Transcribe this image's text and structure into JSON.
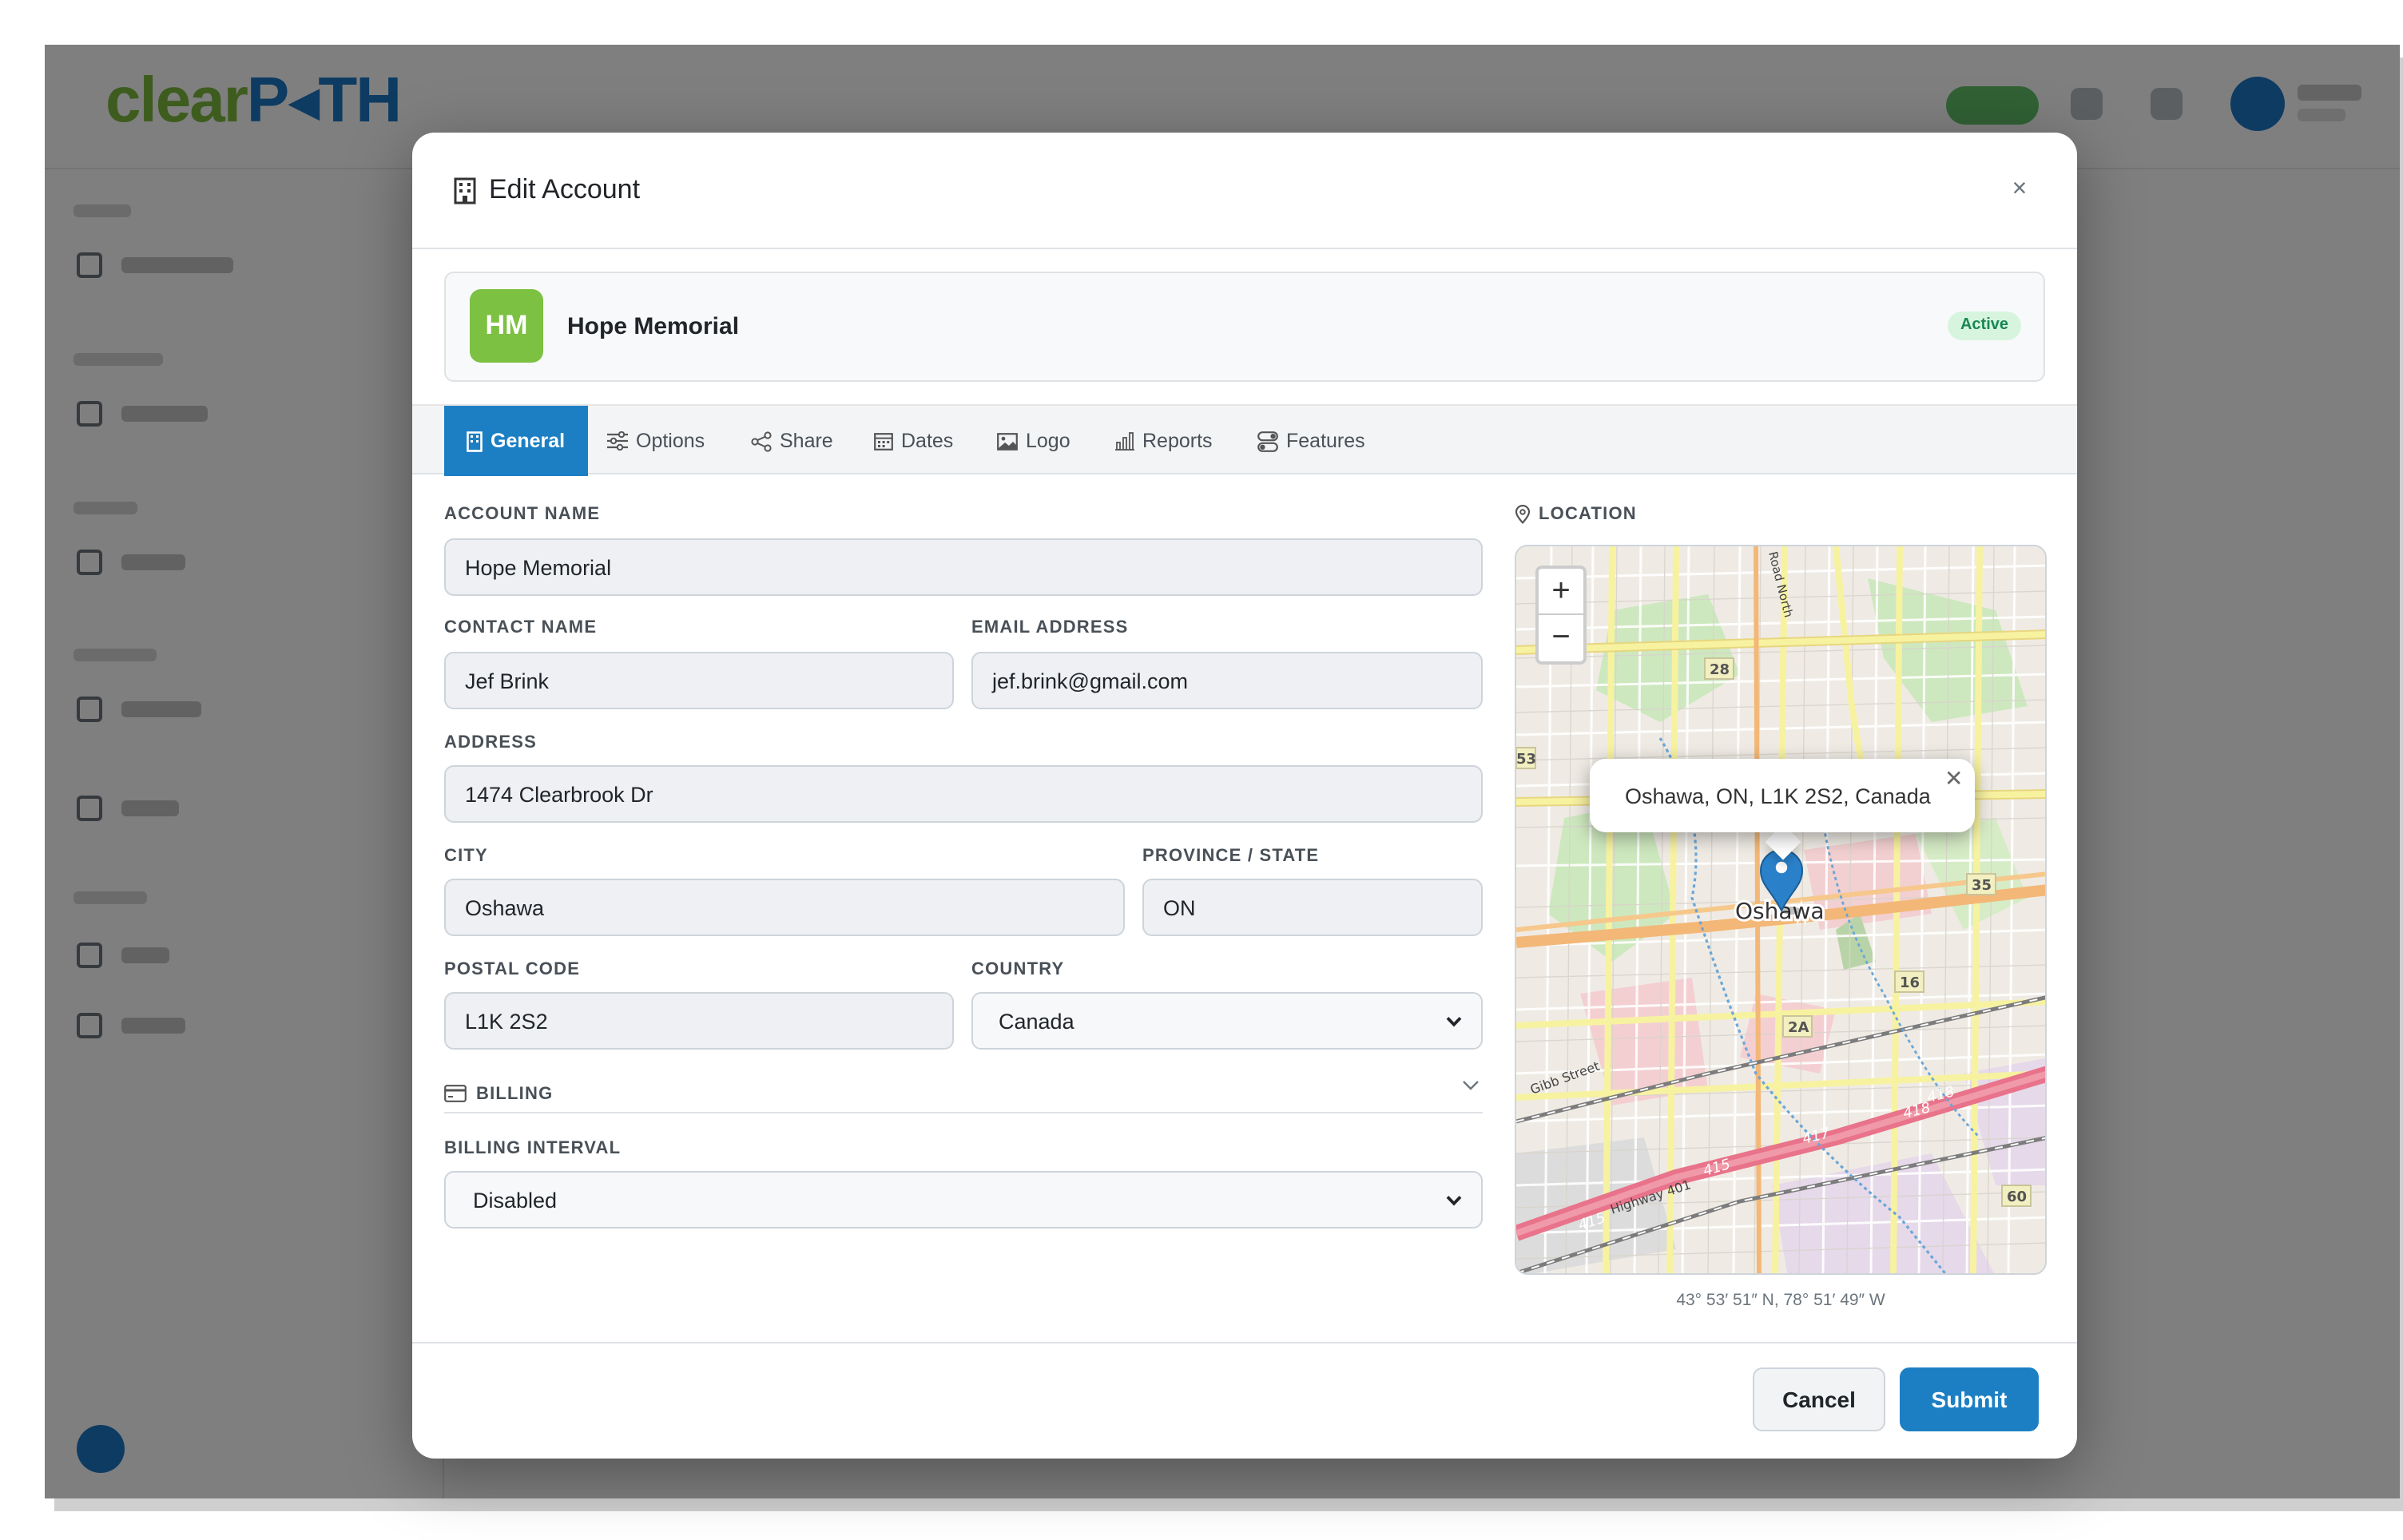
{
  "background_app": {
    "logo_part1": "clear",
    "logo_part2": "P◂TH"
  },
  "modal": {
    "title": "Edit Account",
    "close_label": "×"
  },
  "account": {
    "initials": "HM",
    "name": "Hope Memorial",
    "status": "Active",
    "avatar_color": "#7cc142"
  },
  "tabs": [
    {
      "label": "General",
      "icon": "building-icon"
    },
    {
      "label": "Options",
      "icon": "sliders-icon"
    },
    {
      "label": "Share",
      "icon": "share-icon"
    },
    {
      "label": "Dates",
      "icon": "calendar-icon"
    },
    {
      "label": "Logo",
      "icon": "image-icon"
    },
    {
      "label": "Reports",
      "icon": "bar-chart-icon"
    },
    {
      "label": "Features",
      "icon": "toggles-icon"
    }
  ],
  "form": {
    "account_name_label": "ACCOUNT NAME",
    "account_name": "Hope Memorial",
    "contact_name_label": "CONTACT NAME",
    "contact_name": "Jef Brink",
    "email_label": "EMAIL ADDRESS",
    "email": "jef.brink@gmail.com",
    "address_label": "ADDRESS",
    "address": "1474 Clearbrook Dr",
    "city_label": "CITY",
    "city": "Oshawa",
    "province_label": "PROVINCE / STATE",
    "province": "ON",
    "postal_label": "POSTAL CODE",
    "postal": "L1K 2S2",
    "country_label": "COUNTRY",
    "country": "Canada",
    "billing_section": "BILLING",
    "billing_interval_label": "BILLING INTERVAL",
    "billing_interval": "Disabled"
  },
  "location": {
    "label": "LOCATION",
    "popup": "Oshawa, ON, L1K 2S2, Canada",
    "city_label": "Oshawa",
    "road_labels": [
      "28",
      "35",
      "16",
      "2A",
      "418",
      "417",
      "415",
      "60",
      "53"
    ],
    "street_gibb": "Gibb Street",
    "street_hwy": "Highway 401",
    "street_road_north": "Road North",
    "coords": "43° 53′ 51″ N, 78° 51′ 49″ W",
    "zoom_in": "+",
    "zoom_out": "−"
  },
  "footer": {
    "cancel": "Cancel",
    "submit": "Submit"
  },
  "colors": {
    "primary": "#1d7fc3",
    "success_text": "#198754",
    "success_bg": "#d7f5de"
  }
}
